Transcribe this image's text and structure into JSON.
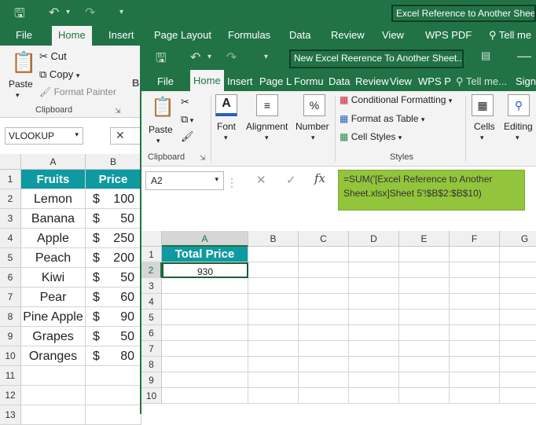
{
  "back_window": {
    "title": "Excel Reference to Another Sheet",
    "tabs": [
      "File",
      "Home",
      "Insert",
      "Page Layout",
      "Formulas",
      "Data",
      "Review",
      "View",
      "WPS PDF",
      "Tell me"
    ],
    "clipboard": {
      "paste": "Paste",
      "cut": "Cut",
      "copy": "Copy",
      "format_painter": "Format Painter",
      "group": "Clipboard"
    },
    "name_box": "VLOOKUP",
    "col_headers": [
      "A",
      "B"
    ],
    "row_headers": [
      "1",
      "2",
      "3",
      "4",
      "5",
      "6",
      "7",
      "8",
      "9",
      "10",
      "11",
      "12",
      "13"
    ],
    "table_header": {
      "fruits": "Fruits",
      "price": "Price"
    },
    "rows": [
      {
        "fruit": "Lemon",
        "cur": "$",
        "price": "100"
      },
      {
        "fruit": "Banana",
        "cur": "$",
        "price": "50"
      },
      {
        "fruit": "Apple",
        "cur": "$",
        "price": "250"
      },
      {
        "fruit": "Peach",
        "cur": "$",
        "price": "200"
      },
      {
        "fruit": "Kiwi",
        "cur": "$",
        "price": "50"
      },
      {
        "fruit": "Pear",
        "cur": "$",
        "price": "60"
      },
      {
        "fruit": "Pine Apple",
        "cur": "$",
        "price": "90"
      },
      {
        "fruit": "Grapes",
        "cur": "$",
        "price": "50"
      },
      {
        "fruit": "Oranges",
        "cur": "$",
        "price": "80"
      }
    ]
  },
  "front_window": {
    "title": "New Excel Reerence To Another Sheet...",
    "tabs": [
      "File",
      "Home",
      "Insert",
      "Page L",
      "Formu",
      "Data",
      "Review",
      "View",
      "WPS P",
      "Tell me...",
      "Sign"
    ],
    "ribbon": {
      "paste": "Paste",
      "clipboard": "Clipboard",
      "font": "Font",
      "alignment": "Alignment",
      "number": "Number",
      "conditional_formatting": "Conditional Formatting",
      "format_as_table": "Format as Table",
      "cell_styles": "Cell Styles",
      "styles": "Styles",
      "cells": "Cells",
      "editing": "Editing"
    },
    "name_box": "A2",
    "formula": "=SUM('[Excel Reference to Another Sheet.xlsx]Sheet 5'!$B$2:$B$10)",
    "col_headers": [
      "A",
      "B",
      "C",
      "D",
      "E",
      "F",
      "G"
    ],
    "row_headers": [
      "1",
      "2",
      "3",
      "4",
      "5",
      "6",
      "7",
      "8",
      "9",
      "10"
    ],
    "header_cell": "Total Price",
    "value_cell": "930"
  }
}
